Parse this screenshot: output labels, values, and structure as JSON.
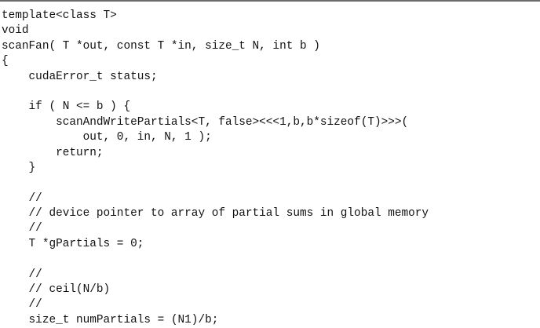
{
  "code": {
    "lines": [
      "template<class T>",
      "void",
      "scanFan( T *out, const T *in, size_t N, int b )",
      "{",
      "    cudaError_t status;",
      "",
      "    if ( N <= b ) {",
      "        scanAndWritePartials<T, false><<<1,b,b*sizeof(T)>>>(",
      "            out, 0, in, N, 1 );",
      "        return;",
      "    }",
      "",
      "    //",
      "    // device pointer to array of partial sums in global memory",
      "    //",
      "    T *gPartials = 0;",
      "",
      "    //",
      "    // ceil(N/b)",
      "    //",
      "    size_t numPartials = (N1)/b;"
    ]
  }
}
